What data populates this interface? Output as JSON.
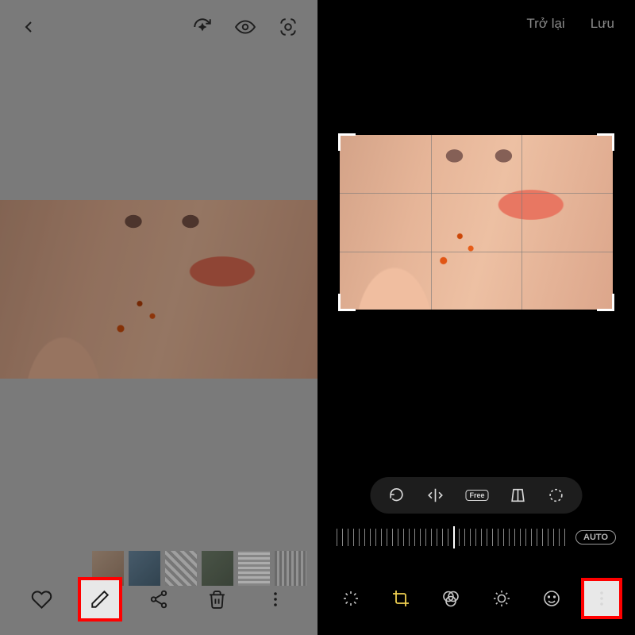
{
  "left": {
    "topIcons": {
      "back": "back-icon",
      "remaster": "remaster-icon",
      "eye": "eye-icon",
      "lens": "bixby-vision-icon"
    },
    "bottom": {
      "heart_label": "Favorite",
      "edit_label": "Edit",
      "share_label": "Share",
      "trash_label": "Delete",
      "more_label": "More"
    }
  },
  "right": {
    "back_label": "Trở lại",
    "save_label": "Lưu",
    "toolpill": {
      "rotate": "rotate-icon",
      "flip": "flip-icon",
      "free_label": "Free",
      "perspective": "perspective-icon",
      "lasso": "lasso-icon"
    },
    "auto_label": "AUTO",
    "bottom": {
      "magic": "auto-enhance",
      "crop": "crop",
      "filters": "filters",
      "brightness": "brightness",
      "emoji": "stickers",
      "more": "more"
    }
  }
}
